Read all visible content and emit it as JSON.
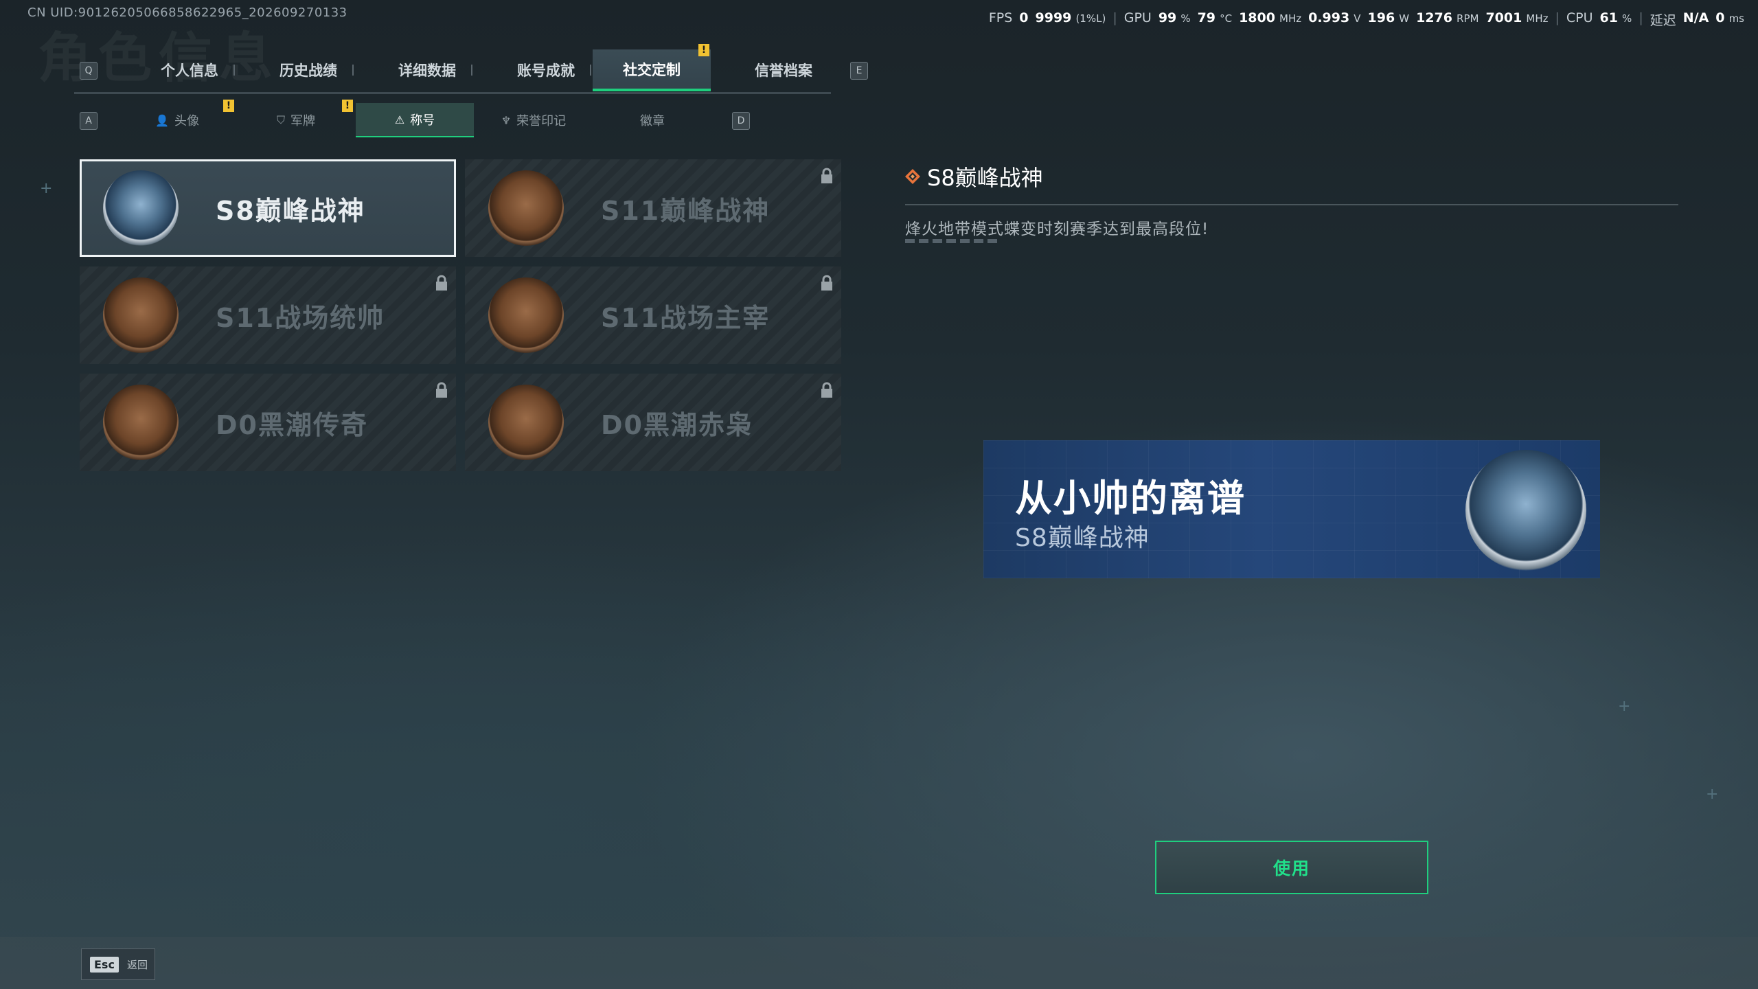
{
  "uid": "CN UID:9012620506685862​2965_202609270133",
  "watermark": "角色信息",
  "perf": {
    "fps_label": "FPS",
    "fps_value": "0",
    "fps_low": "9999",
    "fps_low_suffix": "(1%L)",
    "gpu_label": "GPU",
    "gpu_usage": "99",
    "gpu_usage_unit": "%",
    "gpu_temp": "79",
    "gpu_temp_unit": "°C",
    "gpu_clock": "1800",
    "gpu_clock_unit": "MHz",
    "gpu_voltage": "0.993",
    "gpu_voltage_unit": "V",
    "gpu_power": "196",
    "gpu_power_unit": "W",
    "fan": "1276",
    "fan_unit": "RPM",
    "mem_clock": "7001",
    "mem_clock_unit": "MHz",
    "cpu_label": "CPU",
    "cpu_usage": "61",
    "cpu_usage_unit": "%",
    "latency_label": "延迟",
    "latency_value": "N/A",
    "ping_value": "0",
    "ping_unit": "ms"
  },
  "keys": {
    "prev_tab": "Q",
    "next_tab": "E",
    "prev_sub": "A",
    "next_sub": "D"
  },
  "tabs": [
    {
      "label": "个人信息"
    },
    {
      "label": "历史战绩"
    },
    {
      "label": "详细数据"
    },
    {
      "label": "账号成就"
    },
    {
      "label": "社交定制",
      "active": true,
      "notification": "!"
    },
    {
      "label": "信誉档案"
    }
  ],
  "subtabs": [
    {
      "label": "头像",
      "icon": "person-icon",
      "glyph": "👤",
      "notification": "!"
    },
    {
      "label": "军牌",
      "icon": "tag-icon",
      "glyph": "⛉",
      "notification": "!"
    },
    {
      "label": "称号",
      "icon": "triangle-icon",
      "glyph": "⚠",
      "active": true
    },
    {
      "label": "荣誉印记",
      "icon": "wings-icon",
      "glyph": "♆"
    },
    {
      "label": "徽章",
      "icon": "",
      "glyph": ""
    }
  ],
  "titles": [
    {
      "name": "S8巅峰战神",
      "emblem": "blue-wings-emblem",
      "selected": true,
      "locked": false
    },
    {
      "name": "S11巅峰战神",
      "emblem": "bronze-tank-emblem",
      "locked": true
    },
    {
      "name": "S11战场统帅",
      "emblem": "bronze-apc-emblem",
      "locked": true
    },
    {
      "name": "S11战场主宰",
      "emblem": "bronze-arch-emblem",
      "locked": true
    },
    {
      "name": "D0黑潮传奇",
      "emblem": "bronze-hooded-emblem",
      "locked": true
    },
    {
      "name": "D0黑潮赤枭",
      "emblem": "bronze-skull-emblem",
      "locked": true
    }
  ],
  "detail": {
    "title": "S8巅峰战神",
    "description": "烽火地带模式蝶变时刻赛季达到最高段位!"
  },
  "preview": {
    "player_name": "从小帅的离谱",
    "title": "S8巅峰战神"
  },
  "use_button": "使用",
  "footer": {
    "esc_key": "Esc",
    "esc_label": "返回"
  },
  "colors": {
    "accent_green": "#1fcf7e",
    "notification_yellow": "#f1c232",
    "preview_blue": "#25477a"
  }
}
